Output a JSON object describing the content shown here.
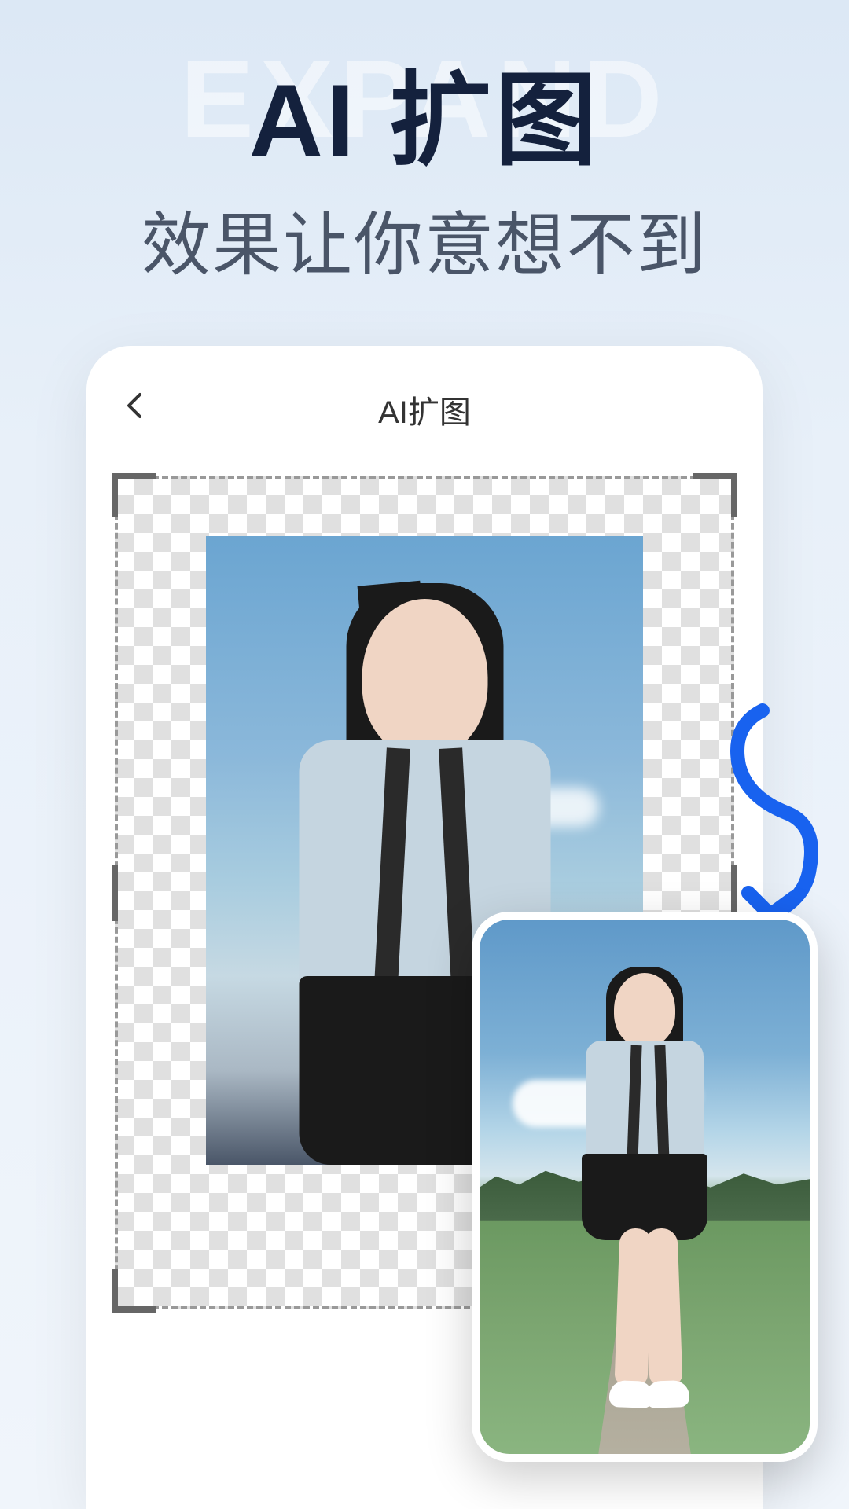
{
  "bg_watermark": "EXPAND",
  "headline": {
    "main": "AI 扩图",
    "sub": "效果让你意想不到"
  },
  "phone": {
    "title": "AI扩图",
    "back_icon": "chevron-left"
  },
  "arrow": {
    "color": "#1862ef"
  }
}
